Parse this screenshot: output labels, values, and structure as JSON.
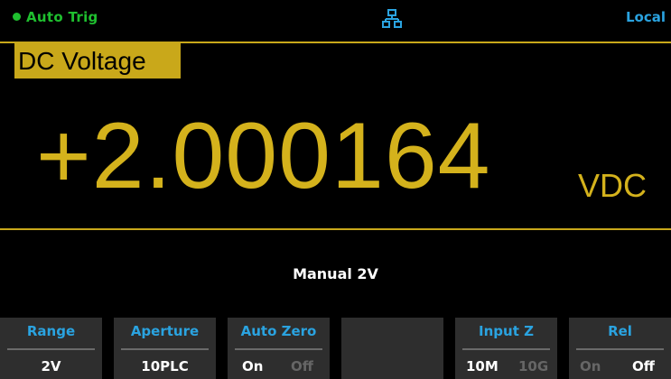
{
  "status": {
    "trigger": "Auto Trig",
    "remote": "Local",
    "network_icon": "network-icon"
  },
  "mode": "DC Voltage",
  "reading": {
    "value": "+2.000164",
    "unit": "VDC"
  },
  "range_info": "Manual 2V",
  "softkeys": [
    {
      "label": "Range",
      "value": "2V"
    },
    {
      "label": "Aperture",
      "value": "10PLC"
    },
    {
      "label": "Auto Zero",
      "options": [
        "On",
        "Off"
      ],
      "selected": "On"
    },
    {
      "label": "",
      "value": ""
    },
    {
      "label": "Input Z",
      "options": [
        "10M",
        "10G"
      ],
      "selected": "10M"
    },
    {
      "label": "Rel",
      "options": [
        "On",
        "Off"
      ],
      "selected": "Off"
    }
  ],
  "colors": {
    "accent": "#c9a81a",
    "status_green": "#1fbf2f",
    "label_blue": "#2aa3e0"
  }
}
